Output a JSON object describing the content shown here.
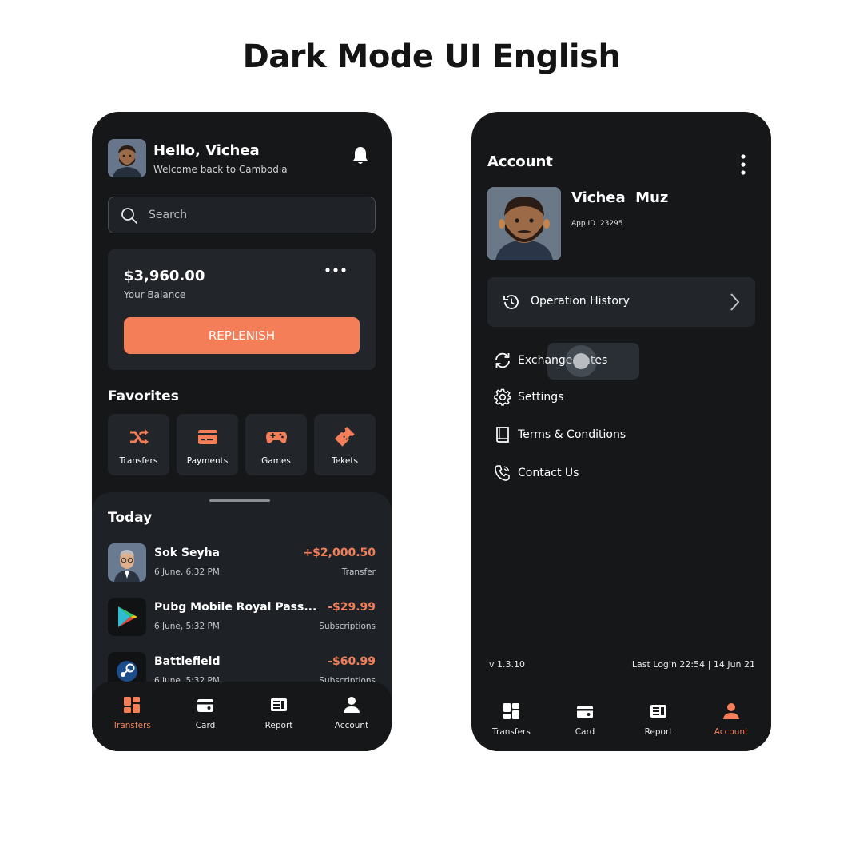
{
  "page": {
    "title": "Dark Mode UI English"
  },
  "colors": {
    "accent": "#f47e58",
    "phone_bg": "#161718",
    "card_bg": "#22262b"
  },
  "home": {
    "greeting": "Hello, Vichea",
    "subtitle": "Welcome back to Cambodia",
    "search": {
      "placeholder": "Search"
    },
    "balance": {
      "amount": "$3,960.00",
      "label": "Your Balance",
      "button": "REPLENISH"
    },
    "favorites": {
      "title": "Favorites",
      "items": [
        {
          "label": "Transfers",
          "icon": "shuffle-icon"
        },
        {
          "label": "Payments",
          "icon": "credit-card-icon"
        },
        {
          "label": "Games",
          "icon": "gamepad-icon"
        },
        {
          "label": "Tekets",
          "icon": "ticket-icon"
        }
      ]
    },
    "today": {
      "title": "Today",
      "transactions": [
        {
          "name": "Sok Seyha",
          "date": "6 June, 6:32 PM",
          "amount": "+$2,000.50",
          "type": "Transfer",
          "icon": "person-avatar"
        },
        {
          "name": "Pubg Mobile Royal Pass...",
          "date": "6 June, 5:32 PM",
          "amount": "-$29.99",
          "type": "Subscriptions",
          "icon": "google-play-icon"
        },
        {
          "name": "Battlefield",
          "date": "6 June, 5:32 PM",
          "amount": "-$60.99",
          "type": "Subscriptions",
          "icon": "steam-icon"
        }
      ]
    },
    "tabs": [
      {
        "label": "Transfers",
        "icon": "dashboard-icon",
        "active": true
      },
      {
        "label": "Card",
        "icon": "wallet-icon",
        "active": false
      },
      {
        "label": "Report",
        "icon": "report-icon",
        "active": false
      },
      {
        "label": "Account",
        "icon": "user-icon",
        "active": false
      }
    ]
  },
  "account": {
    "title": "Account",
    "name": "Vichea  Muz",
    "app_id": "App ID :23295",
    "operation_history": "Operation History",
    "menu": [
      {
        "label": "Exchange Rates",
        "icon": "refresh-icon"
      },
      {
        "label": "Settings",
        "icon": "gear-icon"
      },
      {
        "label": "Terms & Conditions",
        "icon": "book-icon"
      },
      {
        "label": "Contact Us",
        "icon": "phone-icon"
      }
    ],
    "version": "v 1.3.10",
    "last_login": "Last Login 22:54 | 14 Jun 21",
    "tabs": [
      {
        "label": "Transfers",
        "icon": "dashboard-icon",
        "active": false
      },
      {
        "label": "Card",
        "icon": "wallet-icon",
        "active": false
      },
      {
        "label": "Report",
        "icon": "report-icon",
        "active": false
      },
      {
        "label": "Account",
        "icon": "user-icon",
        "active": true
      }
    ]
  }
}
